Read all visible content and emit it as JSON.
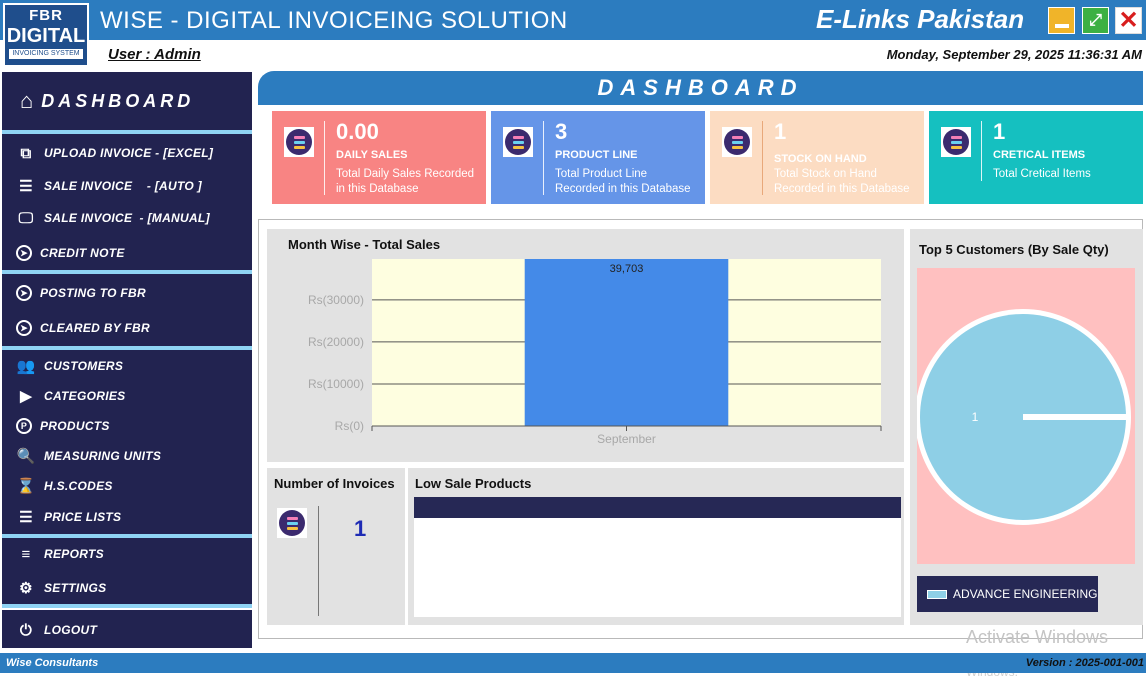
{
  "app": {
    "logo_top": "FBR",
    "logo_main": "DIGITAL",
    "logo_sub": "INVOICING SYSTEM",
    "title": "WISE - DIGITAL INVOICEING SOLUTION",
    "company": "E-Links Pakistan",
    "user": "User : Admin",
    "datetime": "Monday, September 29, 2025 11:36:31 AM"
  },
  "window_controls": {
    "close_glyph": "✕",
    "maximize_glyph": "⤢"
  },
  "sidebar": {
    "dashboard_label": "DASHBOARD",
    "items": [
      {
        "label": "UPLOAD INVOICE - [EXCEL]",
        "icon": "copy-icon"
      },
      {
        "label": "SALE INVOICE    - [AUTO ]",
        "icon": "list-icon"
      },
      {
        "label": "SALE INVOICE  - [MANUAL]",
        "icon": "monitor-icon"
      },
      {
        "label": "CREDIT NOTE",
        "icon": "compass-icon"
      },
      {
        "label": "POSTING TO FBR",
        "icon": "compass-icon"
      },
      {
        "label": "CLEARED BY FBR",
        "icon": "compass-icon"
      },
      {
        "label": "CUSTOMERS",
        "icon": "users-icon"
      },
      {
        "label": "CATEGORIES",
        "icon": "play-square-icon"
      },
      {
        "label": "PRODUCTS",
        "icon": "product-icon"
      },
      {
        "label": "MEASURING UNITS",
        "icon": "zoom-icon"
      },
      {
        "label": "H.S.CODES",
        "icon": "hourglass-icon"
      },
      {
        "label": "PRICE LISTS",
        "icon": "list-icon"
      },
      {
        "label": "REPORTS",
        "icon": "report-icon"
      },
      {
        "label": "SETTINGS",
        "icon": "gears-icon"
      },
      {
        "label": "LOGOUT",
        "icon": "power-icon"
      }
    ]
  },
  "main": {
    "header": "DASHBOARD"
  },
  "cards": {
    "sales": {
      "value": "0.00",
      "label": "DAILY SALES",
      "sub1": "Total Daily Sales Recorded",
      "sub2": "in this Database",
      "color": "#f88483"
    },
    "product": {
      "value": "3",
      "label": "PRODUCT LINE",
      "sub1": "Total Product Line",
      "sub2": "Recorded in this Database",
      "color": "#6595e8"
    },
    "stock": {
      "value": "1",
      "label": "STOCK ON HAND",
      "sub1": "Total Stock on Hand",
      "sub2": "Recorded in this Database",
      "color": "#fcdcc2"
    },
    "critical": {
      "value": "1",
      "label": "CRETICAL ITEMS",
      "sub1": "Total Cretical Items",
      "color": "#15c0c0"
    }
  },
  "invoices": {
    "title": "Number of Invoices",
    "count": "1"
  },
  "low_sale": {
    "title": "Low Sale Products"
  },
  "top5": {
    "title": "Top 5 Customers (By Sale Qty)"
  },
  "watermark": {
    "title": "Activate Windows",
    "subtitle": "Go to Settings to activate Windows."
  },
  "status": {
    "left": "Wise Consultants",
    "right": "Version : 2025-001-001"
  },
  "chart_data": [
    {
      "type": "bar",
      "title": "Month Wise - Total Sales",
      "categories": [
        "September"
      ],
      "values": [
        39703
      ],
      "data_labels": [
        "39,703"
      ],
      "yticks": [
        "Rs(0)",
        "Rs(10000)",
        "Rs(20000)",
        "Rs(30000)"
      ],
      "ylim": [
        0,
        39703
      ],
      "grid": true,
      "bar_color": "#448ae8",
      "plot_bg": "#fefee0"
    },
    {
      "type": "pie",
      "title": "Top 5 Customers (By Sale Qty)",
      "categories": [
        "ADVANCE ENGINEERING"
      ],
      "values": [
        1
      ],
      "data_labels": [
        "1"
      ],
      "legend": "bottom-left",
      "slice_color": "#8ecfe6"
    }
  ]
}
